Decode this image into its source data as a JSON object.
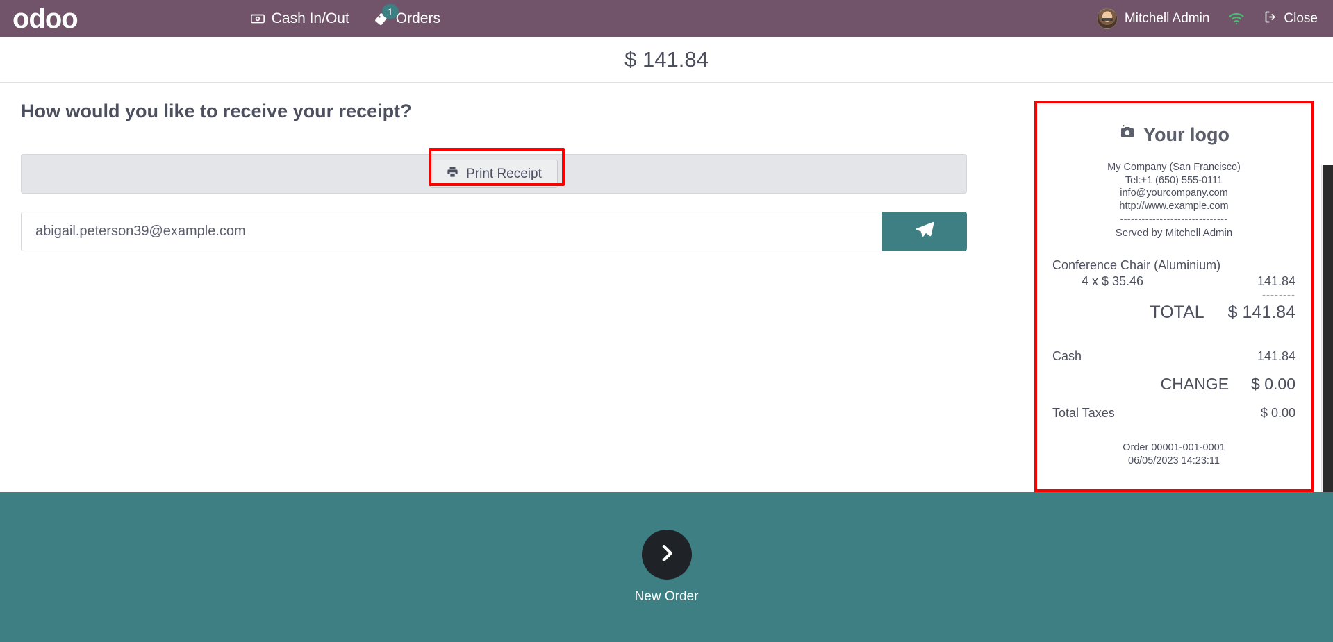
{
  "topbar": {
    "logo": "odoo",
    "items": [
      {
        "label": "Cash In/Out",
        "icon": "money-bill-icon",
        "badge": null
      },
      {
        "label": "Orders",
        "icon": "tag-icon",
        "badge": "1"
      }
    ],
    "user_name": "Mitchell Admin",
    "wifi_icon": "wifi-icon",
    "close_label": "Close",
    "close_icon": "sign-out-icon",
    "bar_color": "#71546a",
    "badge_color": "#3d7f82"
  },
  "amount_bar": {
    "total": "$ 141.84"
  },
  "main": {
    "title": "How would you like to receive your receipt?",
    "print_button": {
      "label": "Print Receipt",
      "icon": "printer-icon",
      "highlight_color": "#ff0000"
    },
    "email": {
      "value": "abigail.peterson39@example.com",
      "placeholder": "email@example.com",
      "send_icon": "paper-plane-icon",
      "send_color": "#3d7f82"
    }
  },
  "receipt": {
    "logo_text": "Your logo",
    "logo_icon": "camera-icon",
    "company_lines": [
      "My Company (San Francisco)",
      "Tel:+1 (650) 555-0111",
      "info@yourcompany.com",
      "http://www.example.com"
    ],
    "divider": "------------------------------",
    "served_by": "Served by Mitchell Admin",
    "lines": [
      {
        "name": "Conference Chair (Aluminium)",
        "qty_price": "4 x $ 35.46",
        "amount": "141.84"
      }
    ],
    "total_separator": "--------",
    "total_label": "TOTAL",
    "total_value": "$ 141.84",
    "payments": [
      {
        "label": "Cash",
        "value": "141.84"
      }
    ],
    "change_label": "CHANGE",
    "change_value": "$ 0.00",
    "taxes_label": "Total Taxes",
    "taxes_value": "$ 0.00",
    "order_number": "Order 00001-001-0001",
    "order_datetime": "06/05/2023 14:23:11",
    "highlight_color": "#ff0000"
  },
  "footer": {
    "new_order_label": "New Order",
    "new_order_icon": "chevron-right-icon",
    "background": "#3d7f82"
  }
}
